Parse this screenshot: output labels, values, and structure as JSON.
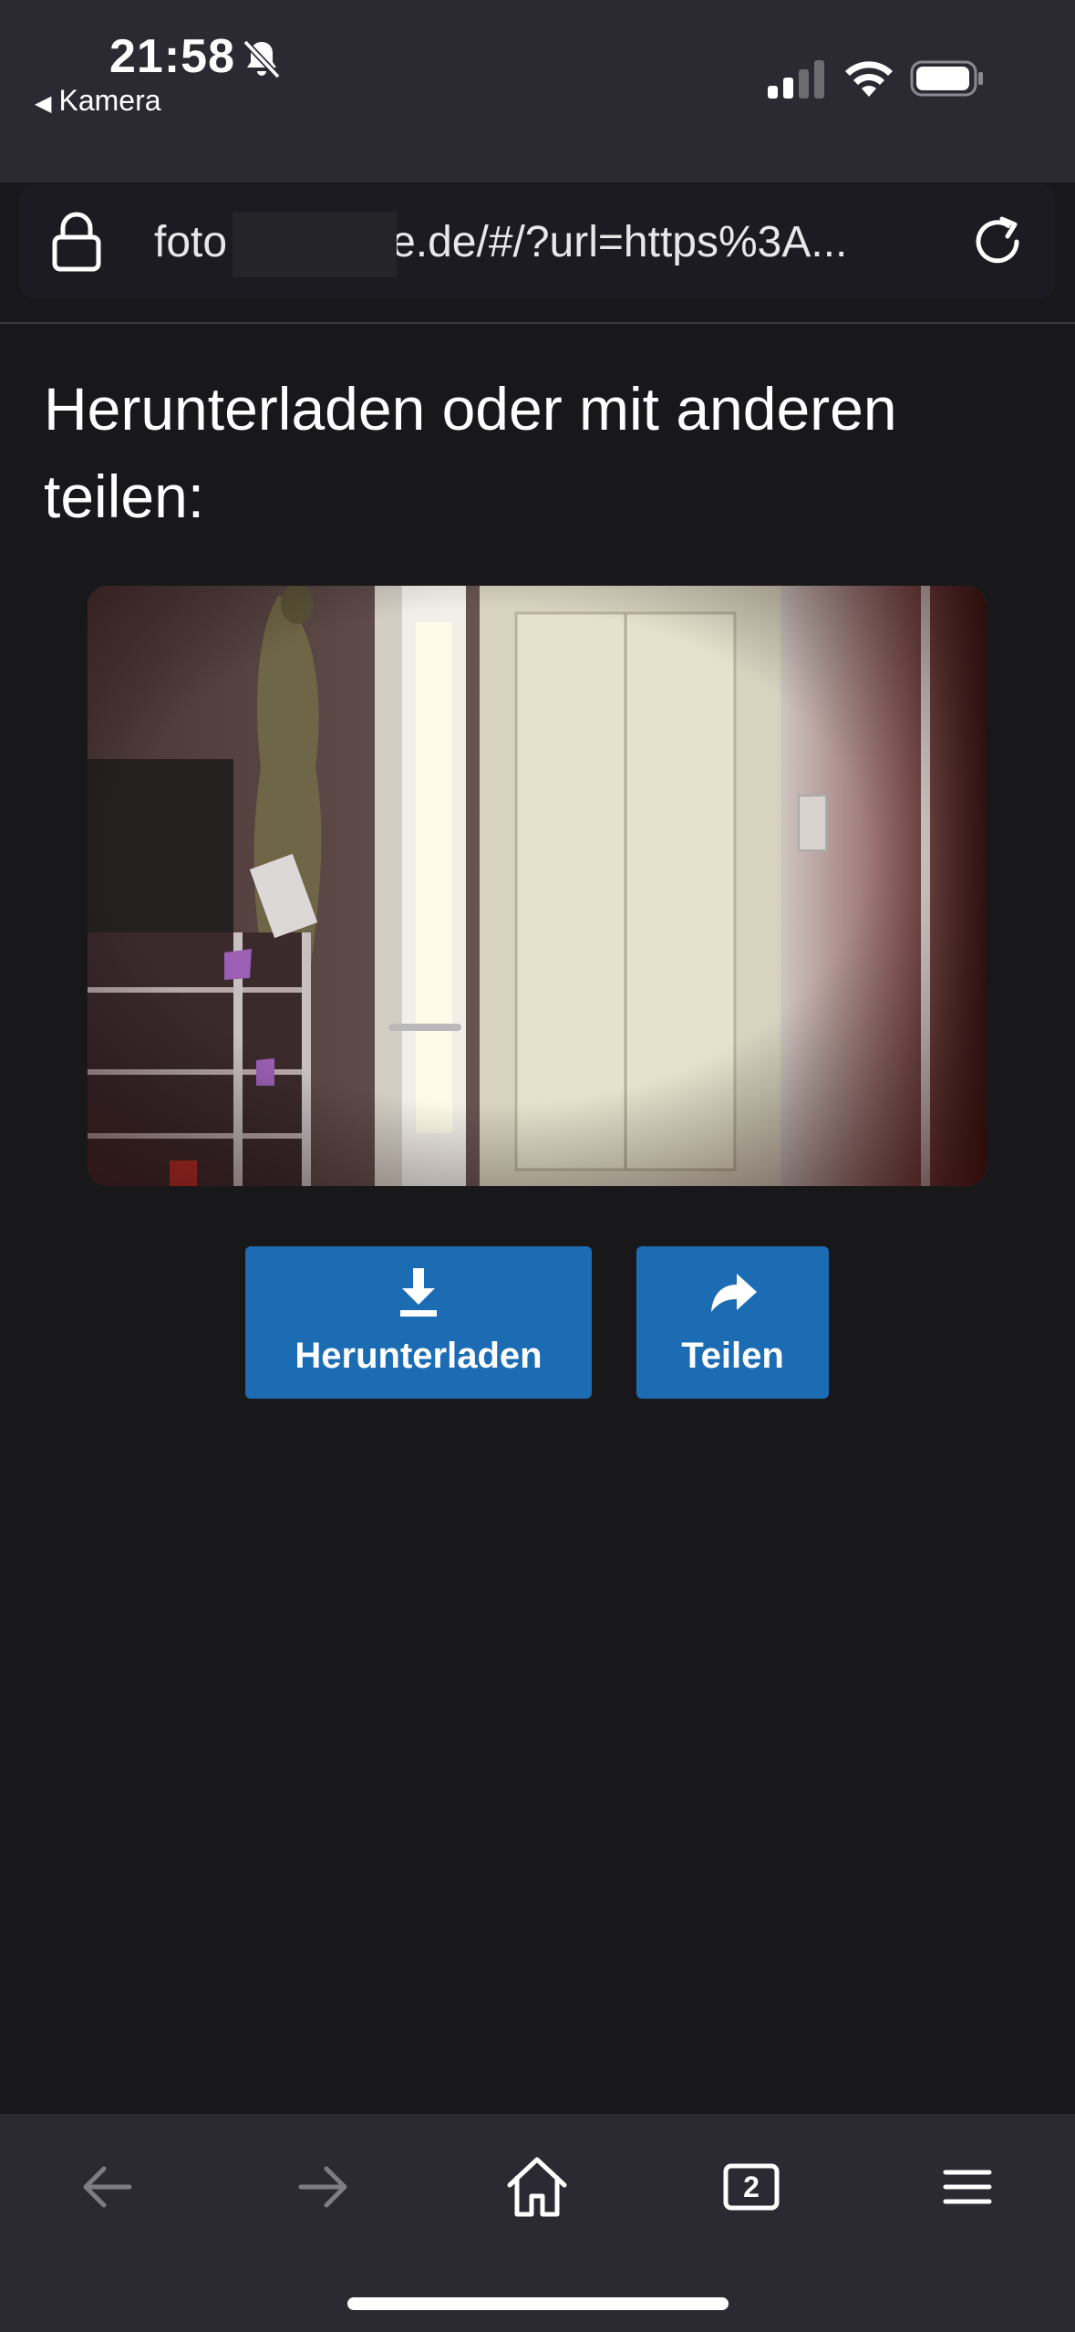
{
  "status": {
    "time": "21:58",
    "back_app": "Kamera"
  },
  "browser": {
    "url": "foto",
    "url_suffix": "e.de/#/?url=https%3A...",
    "tab_count": "2"
  },
  "page": {
    "heading": "Herunterladen oder mit anderen teilen:",
    "download_label": "Herunterladen",
    "share_label": "Teilen"
  },
  "colors": {
    "button": "#1c6cb4",
    "background": "#18181a",
    "chrome": "#2b2a33"
  }
}
